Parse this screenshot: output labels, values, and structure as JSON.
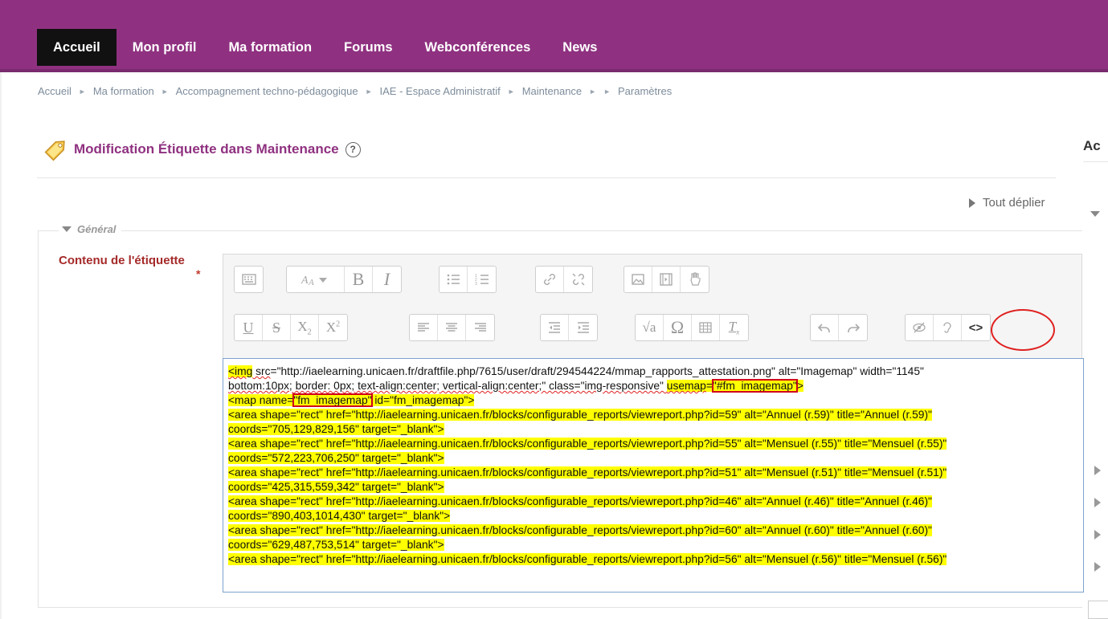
{
  "nav": {
    "items": [
      "Accueil",
      "Mon profil",
      "Ma formation",
      "Forums",
      "Webconférences",
      "News"
    ]
  },
  "breadcrumb": [
    "Accueil",
    "Ma formation",
    "Accompagnement techno-pédagogique",
    "IAE - Espace Administratif",
    "Maintenance",
    "",
    "Paramètres"
  ],
  "page": {
    "title": "Modification Étiquette dans Maintenance",
    "help": "?",
    "expand_all": "Tout déplier",
    "right_label": "Ac"
  },
  "form": {
    "section_legend": "Général",
    "field_label": "Contenu de l'étiquette",
    "required": "*"
  },
  "toolbar": {
    "source_label": "<>"
  },
  "icons": [
    "toolbar-toggle-icon",
    "font-style-icon",
    "bold-icon",
    "italic-icon",
    "unordered-list-icon",
    "ordered-list-icon",
    "link-icon",
    "unlink-icon",
    "image-icon",
    "media-icon",
    "paste-icon",
    "underline-icon",
    "strikethrough-icon",
    "subscript-icon",
    "superscript-icon",
    "align-left-icon",
    "align-center-icon",
    "align-right-icon",
    "outdent-icon",
    "indent-icon",
    "equation-icon",
    "special-char-icon",
    "table-icon",
    "clear-format-icon",
    "undo-icon",
    "redo-icon",
    "accessibility-checker-icon",
    "screenreader-helper-icon",
    "html-source-icon"
  ],
  "code": {
    "l1_a": "<img",
    "l1_b": " src",
    "l1_c": "=\"http://iaelearning.unicaen.fr/draftfile.php/7615/user/draft/294544224/mmap_rapports_attestation.png\" alt=\"Imagemap\" width=\"1145\"",
    "l2_a": "bottom:10px;",
    "l2_b": "    border: 0px;",
    "l2_c": "     text-align:center;      vertical-align:center;\" class=\"img-responsive\" ",
    "l2_d": "usemap",
    "l2_e": "=",
    "l2_f": "\"#fm_imagemap\"",
    "l2_g": ">",
    "l3_a": "<map name=",
    "l3_b": "\"fm_imagemap\"",
    "l3_c": " id=\"fm_imagemap\">",
    "l4": "<area shape=\"rect\" href=\"http://iaelearning.unicaen.fr/blocks/configurable_reports/viewreport.php?id=59\" alt=\"Annuel (r.59)\" title=\"Annuel (r.59)\"",
    "l5": "coords=\"705,129,829,156\" target=\"_blank\">",
    "l6": "<area shape=\"rect\" href=\"http://iaelearning.unicaen.fr/blocks/configurable_reports/viewreport.php?id=55\" alt=\"Mensuel (r.55)\" title=\"Mensuel (r.55)\"",
    "l7": "coords=\"572,223,706,250\" target=\"_blank\">",
    "l8": "<area shape=\"rect\" href=\"http://iaelearning.unicaen.fr/blocks/configurable_reports/viewreport.php?id=51\" alt=\"Mensuel (r.51)\" title=\"Mensuel (r.51)\"",
    "l9": "coords=\"425,315,559,342\" target=\"_blank\">",
    "l10": "<area shape=\"rect\" href=\"http://iaelearning.unicaen.fr/blocks/configurable_reports/viewreport.php?id=46\" alt=\"Annuel (r.46)\" title=\"Annuel (r.46)\"",
    "l11": "coords=\"890,403,1014,430\" target=\"_blank\">",
    "l12": "<area shape=\"rect\" href=\"http://iaelearning.unicaen.fr/blocks/configurable_reports/viewreport.php?id=60\" alt=\"Annuel (r.60)\" title=\"Annuel (r.60)\"",
    "l13": "coords=\"629,487,753,514\" target=\"_blank\">",
    "l14": "<area shape=\"rect\" href=\"http://iaelearning.unicaen.fr/blocks/configurable_reports/viewreport.php?id=56\" alt=\"Mensuel (r.56)\" title=\"Mensuel (r.56)\""
  },
  "colors": {
    "brand": "#8f3180",
    "highlight": "#ffff00",
    "annotation": "#e02020"
  }
}
